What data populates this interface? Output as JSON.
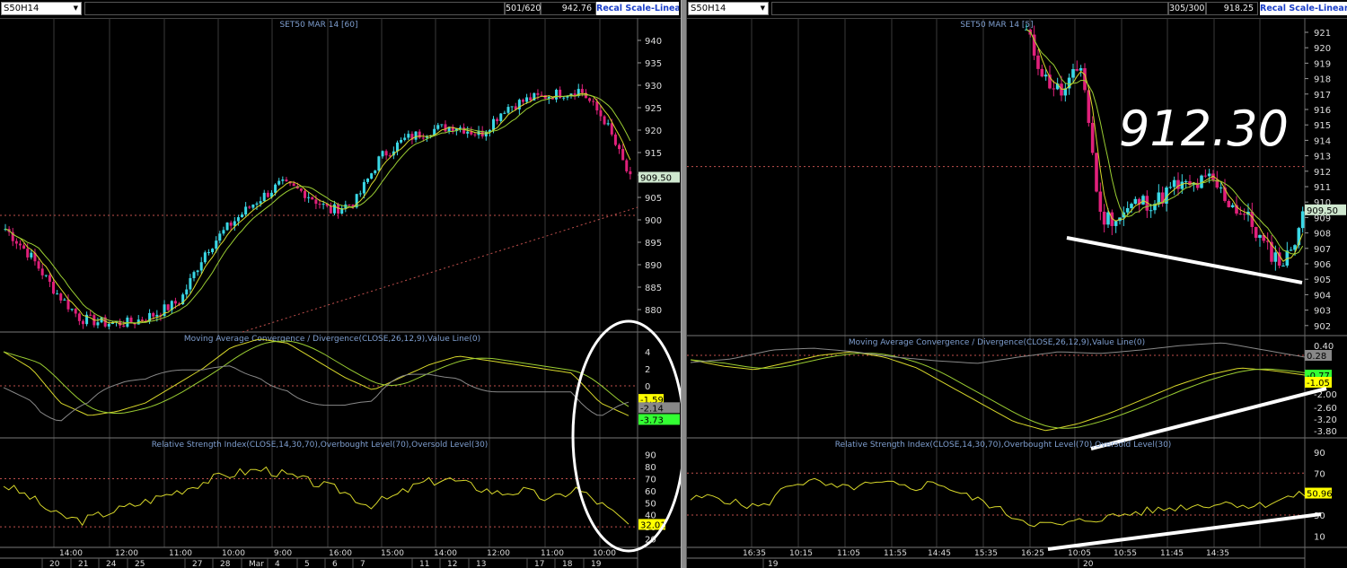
{
  "left": {
    "symbol": "S50H14",
    "bar_info": "501/620",
    "last_value": "942.76",
    "scale_button": "Recal Scale-Linear",
    "price_title": "SET50 MAR 14  [60]",
    "price_axis": [
      "940",
      "935",
      "930",
      "925",
      "920",
      "915",
      "910",
      "905",
      "900",
      "895",
      "890",
      "885",
      "880"
    ],
    "price_badge": "909.50",
    "macd_title": "Moving Average Convergence / Divergence(CLOSE,26,12,9),Value Line(0)",
    "macd_axis": [
      "4",
      "2",
      "0"
    ],
    "macd_badges": [
      "-1.59",
      "-2.14",
      "-3.73"
    ],
    "rsi_title": "Relative Strength Index(CLOSE,14,30,70),Overbought Level(70),Oversold Level(30)",
    "rsi_axis": [
      "90",
      "80",
      "70",
      "60",
      "50",
      "40",
      "30",
      "20"
    ],
    "rsi_badge": "32.01",
    "time_labels": [
      "14:00",
      "12:00",
      "11:00",
      "10:00",
      "9:00",
      "16:00",
      "15:00",
      "14:00",
      "12:00",
      "11:00",
      "10:00"
    ],
    "date_labels": [
      "20",
      "21",
      "24",
      "25",
      "27",
      "28",
      "Mar",
      "4",
      "5",
      "6",
      "7",
      "11",
      "12",
      "13",
      "17",
      "18",
      "19"
    ]
  },
  "right": {
    "symbol": "S50H14",
    "bar_info": "305/300",
    "last_value": "918.25",
    "scale_button": "Recal Scale-Linear",
    "price_title": "SET50 MAR 14  [5]",
    "price_axis": [
      "921",
      "920",
      "919",
      "918",
      "917",
      "916",
      "915",
      "914",
      "913",
      "912",
      "911",
      "910",
      "909",
      "908",
      "907",
      "906",
      "905",
      "904",
      "903",
      "902"
    ],
    "price_badge": "909.50",
    "big_price": "912.30",
    "macd_title": "Moving Average Convergence / Divergence(CLOSE,26,12,9),Value Line(0)",
    "macd_axis": [
      "0.40",
      "-2.00",
      "-2.60",
      "-3.20",
      "-3.80"
    ],
    "macd_badges": [
      "0.28",
      "-0.77",
      "-1.05"
    ],
    "rsi_title": "Relative Strength Index(CLOSE,14,30,70),Overbought Level(70),Oversold Level(30)",
    "rsi_axis": [
      "90",
      "70",
      "50",
      "30",
      "10"
    ],
    "rsi_badge": "50.96",
    "time_labels": [
      "16:35",
      "10:15",
      "11:05",
      "11:55",
      "14:45",
      "15:35",
      "16:25",
      "10:05",
      "10:55",
      "11:45",
      "14:35"
    ],
    "date_labels": [
      "19",
      "20"
    ]
  },
  "colors": {
    "up_candle": "#3ad8e6",
    "down_candle": "#e0207a",
    "ma_fast": "#d8d82a",
    "ma_slow": "#9acd32",
    "grid": "#3a3a3a",
    "ref_line": "#c0504d",
    "axis_text": "#dddddd",
    "title_text": "#7f9fd0"
  },
  "annotations": {
    "left_ellipse": "white ellipse around latest MACD/RSI values",
    "right_trendlines": "white divergence trend lines on price, MACD and RSI"
  }
}
